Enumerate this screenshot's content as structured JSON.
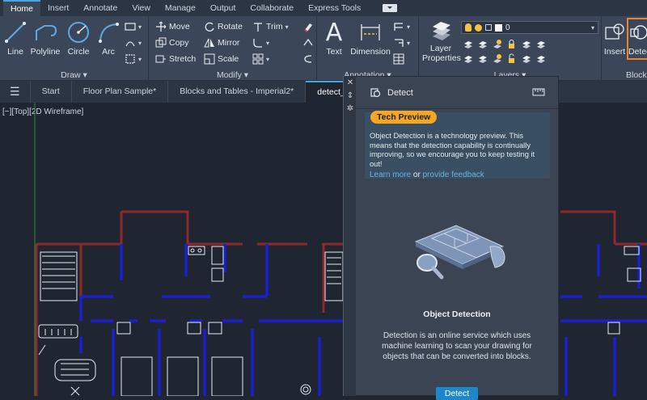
{
  "menu": {
    "tabs": [
      "Home",
      "Insert",
      "Annotate",
      "View",
      "Manage",
      "Output",
      "Collaborate",
      "Express Tools"
    ],
    "active": "Home"
  },
  "ribbon": {
    "draw": {
      "title": "Draw ▾",
      "line": "Line",
      "polyline": "Polyline",
      "circle": "Circle",
      "arc": "Arc"
    },
    "modify": {
      "title": "Modify ▾",
      "move": "Move",
      "rotate": "Rotate",
      "trim": "Trim",
      "copy": "Copy",
      "mirror": "Mirror",
      "stretch": "Stretch",
      "scale": "Scale"
    },
    "annotation": {
      "title": "Annotation ▾",
      "text": "Text",
      "dimension": "Dimension"
    },
    "layers": {
      "title": "Layers ▾",
      "layer_properties": "Layer Properties",
      "current_layer": "0"
    },
    "block": {
      "title": "Block",
      "insert": "Insert",
      "detect": "Detect"
    }
  },
  "doc_tabs": [
    "Start",
    "Floor Plan Sample*",
    "Blocks and Tables - Imperial2*",
    "detect_test*"
  ],
  "active_doc": "detect_test*",
  "viewport_label": "[−][Top][2D Wireframe]",
  "palette": {
    "title": "Detect",
    "badge": "Tech Preview",
    "notice": "Object Detection is a technology preview. This means that the detection capability is continually improving, so we encourage you to keep testing it out!",
    "learn_more": "Learn more",
    "or_text": "or",
    "feedback": "provide feedback",
    "heading": "Object Detection",
    "description": "Detection is an online service which uses machine learning to scan your drawing for objects that can be converted into blocks.",
    "button": "Detect"
  },
  "colors": {
    "accent": "#1d87cc",
    "badge": "#f5a623",
    "wall_blue": "#1a1fd0",
    "wall_red": "#8a2a2a",
    "link": "#5fb3ea"
  }
}
